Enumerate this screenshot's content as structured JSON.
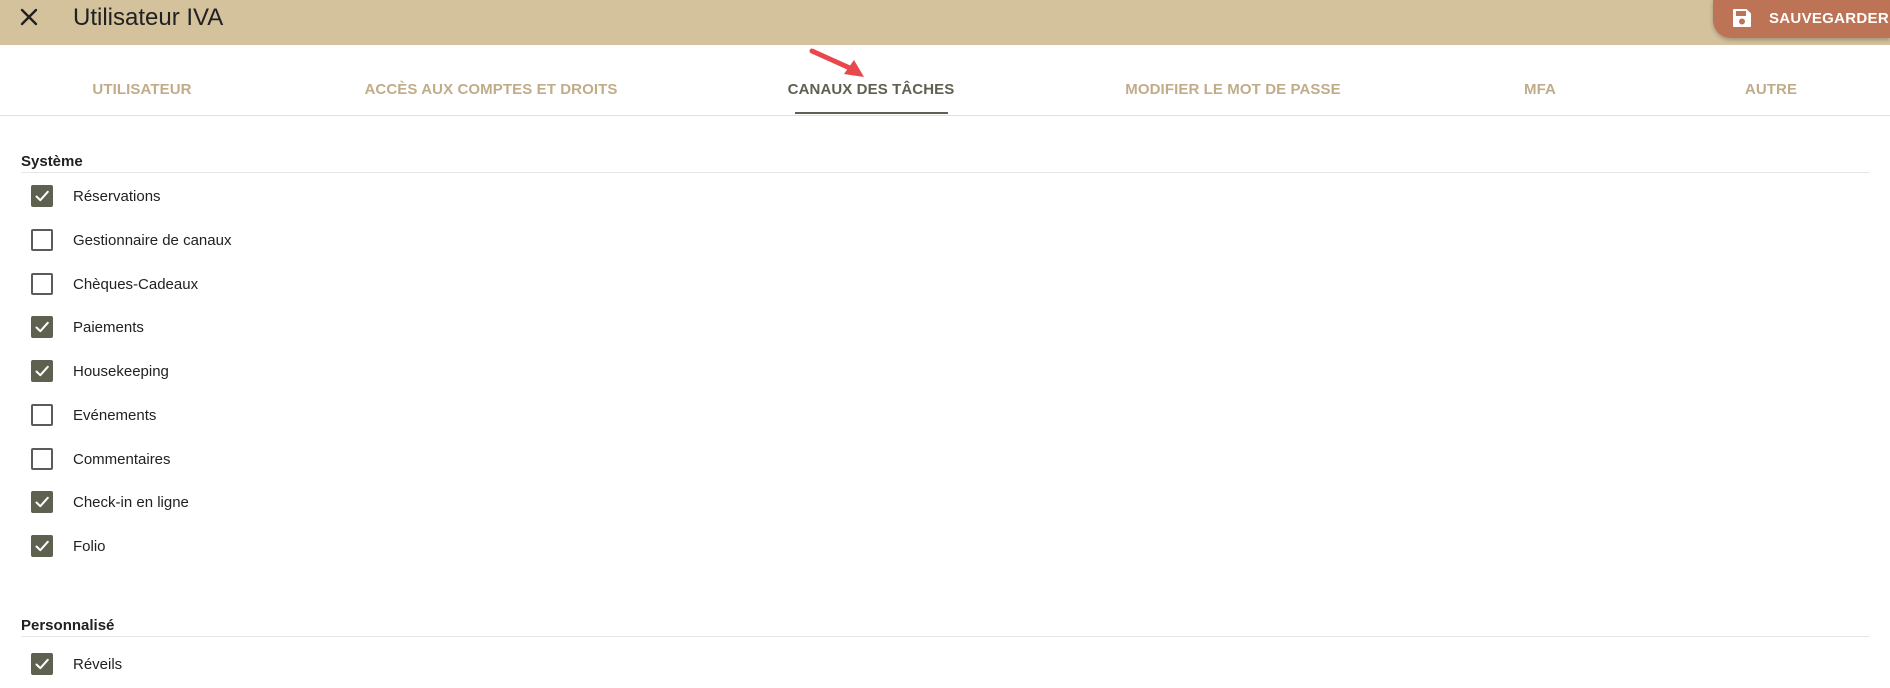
{
  "header": {
    "title": "Utilisateur IVA",
    "save_label": "SAUVEGARDER",
    "background_color": "#d4c29d",
    "save_color": "#bd7355"
  },
  "tabs": [
    {
      "label": "UTILISATEUR",
      "active": false
    },
    {
      "label": "ACCÈS AUX COMPTES ET DROITS",
      "active": false
    },
    {
      "label": "CANAUX DES TÂCHES",
      "active": true
    },
    {
      "label": "MODIFIER LE MOT DE PASSE",
      "active": false
    },
    {
      "label": "MFA",
      "active": false
    },
    {
      "label": "AUTRE",
      "active": false
    }
  ],
  "sections": [
    {
      "title": "Système",
      "items": [
        {
          "label": "Réservations",
          "checked": true
        },
        {
          "label": "Gestionnaire de canaux",
          "checked": false
        },
        {
          "label": "Chèques-Cadeaux",
          "checked": false
        },
        {
          "label": "Paiements",
          "checked": true
        },
        {
          "label": "Housekeeping",
          "checked": true
        },
        {
          "label": "Evénements",
          "checked": false
        },
        {
          "label": "Commentaires",
          "checked": false
        },
        {
          "label": "Check-in en ligne",
          "checked": true
        },
        {
          "label": "Folio",
          "checked": true
        }
      ]
    },
    {
      "title": "Personnalisé",
      "items": [
        {
          "label": "Réveils",
          "checked": true
        }
      ]
    }
  ],
  "icons": {
    "close": "close-icon",
    "save": "floppy-disk-icon",
    "annotation": "red-arrow-annotation",
    "check": "check-icon"
  },
  "colors": {
    "accent": "#5f6150",
    "tab_inactive": "#c1ac8a",
    "annotation": "#e8484b"
  }
}
